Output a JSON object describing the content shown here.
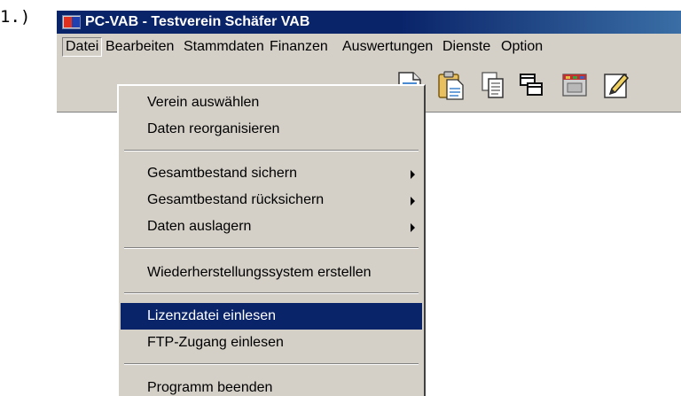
{
  "step_label": "1.)",
  "window": {
    "title": "PC-VAB  -  Testverein Schäfer VAB"
  },
  "menubar": {
    "items": [
      {
        "label": "Datei",
        "active": true
      },
      {
        "label": "Bearbeiten"
      },
      {
        "label": "Stammdaten"
      },
      {
        "label": "Finanzen"
      },
      {
        "label": "Auswertungen"
      },
      {
        "label": "Dienste"
      },
      {
        "label": "Option"
      }
    ]
  },
  "toolbar": {
    "icons": [
      "document-icon",
      "clipboard-paste-icon",
      "copy-icon",
      "windows-icon",
      "calendar-box-icon",
      "edit-pencil-icon"
    ]
  },
  "datei_menu": {
    "items": [
      {
        "label": "Verein auswählen"
      },
      {
        "label": "Daten reorganisieren"
      },
      {
        "label": "Gesamtbestand sichern",
        "submenu": true
      },
      {
        "label": "Gesamtbestand rücksichern",
        "submenu": true
      },
      {
        "label": "Daten auslagern",
        "submenu": true
      },
      {
        "label": "Wiederherstellungssystem erstellen"
      },
      {
        "label": "Lizenzdatei einlesen",
        "selected": true
      },
      {
        "label": "FTP-Zugang einlesen"
      },
      {
        "label": "Programm beenden"
      }
    ]
  },
  "colors": {
    "titlebar": "#0a246a",
    "menu_bg": "#d4d0c8",
    "highlight": "#0a246a"
  }
}
